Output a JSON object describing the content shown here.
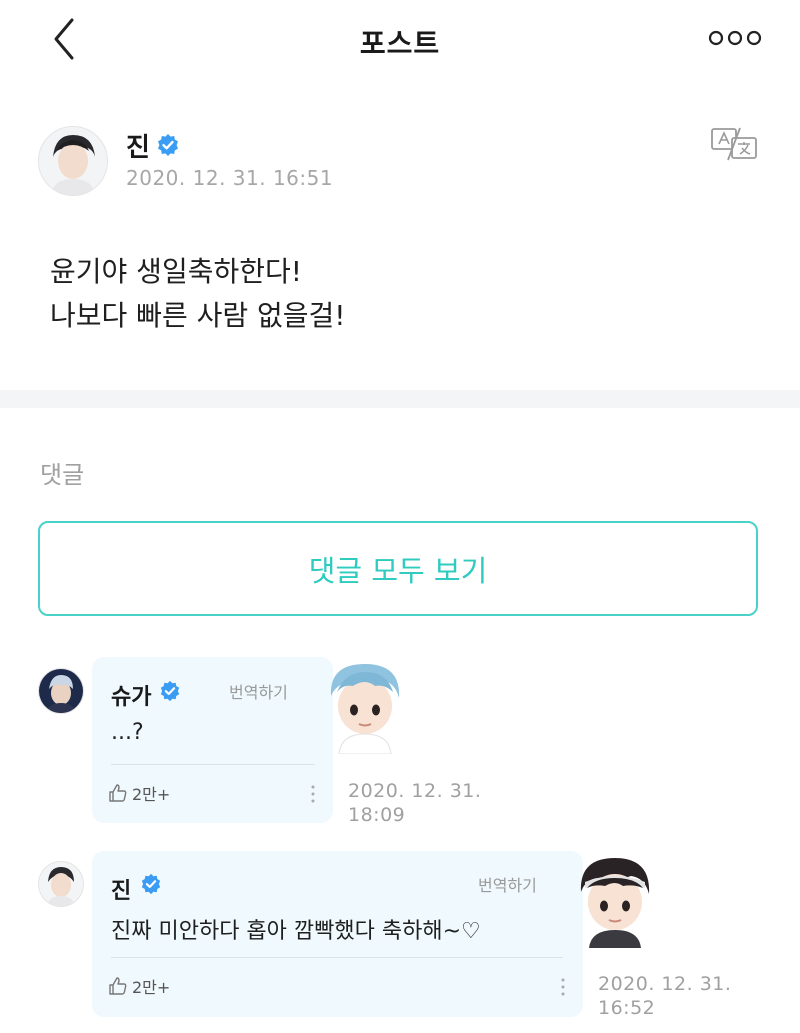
{
  "header": {
    "title": "포스트"
  },
  "post": {
    "author": "진",
    "date": "2020. 12. 31. 16:51",
    "lines": [
      "윤기야 생일축하한다!",
      "나보다 빠른 사람 없을걸!"
    ]
  },
  "comments_section": {
    "label": "댓글",
    "view_all": "댓글 모두 보기",
    "items": [
      {
        "author": "슈가",
        "translate": "번역하기",
        "text": "...?",
        "likes": "2만+",
        "time_line1": "2020. 12. 31.",
        "time_line2": "18:09"
      },
      {
        "author": "진",
        "translate": "번역하기",
        "text": "진짜 미안하다 홉아 깜빡했다 축하해~♡",
        "likes": "2만+",
        "time_line1": "2020. 12. 31.",
        "time_line2": "16:52"
      }
    ]
  },
  "colors": {
    "accent": "#2fcbbf",
    "verified": "#3b9cf4",
    "bubble": "#f0f9fe",
    "muted": "#a0a0a0"
  }
}
